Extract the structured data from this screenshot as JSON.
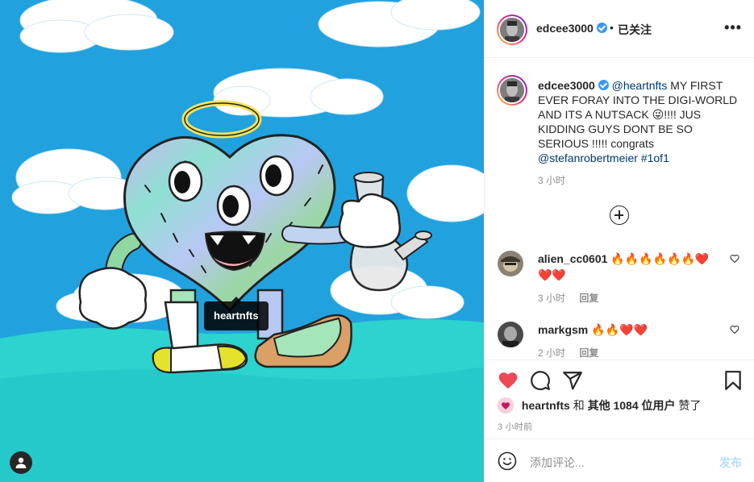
{
  "post": {
    "author": "edcee3000",
    "tagged_user": "heartnfts"
  },
  "header": {
    "username": "edcee3000",
    "separator": "•",
    "follow_label": "已关注",
    "more_icon": "more-icon"
  },
  "caption": {
    "username": "edcee3000",
    "mention": "@heartnfts",
    "text_1": " MY FIRST EVER FORAY INTO THE DIGI-WORLD AND ITS A NUTSACK ",
    "emoji": "😜",
    "text_2": "!!!! JUS KIDDING GUYS DONT BE SO SERIOUS !!!!! congrats ",
    "mention_2": "@stefanrobertmeier",
    "hashtag": "#1of1",
    "time": "3 小时"
  },
  "comments": [
    {
      "username": "alien_cc0601",
      "text": "🔥🔥🔥🔥🔥🔥❤️❤️❤️",
      "time": "3 小时",
      "reply": "回复"
    },
    {
      "username": "markgsm",
      "text": "🔥🔥❤️❤️",
      "time": "2 小时",
      "reply": "回复"
    }
  ],
  "likes": {
    "first_user": "heartnfts",
    "connector": "和",
    "others": "其他 1084 位用户",
    "suffix": "赞了"
  },
  "posted_time": "3 小时前",
  "add_comment": {
    "placeholder": "添加评论...",
    "post_label": "发布"
  },
  "colors": {
    "like_red": "#ed4956",
    "link_blue": "#00376b",
    "verified_blue": "#3897f0"
  }
}
